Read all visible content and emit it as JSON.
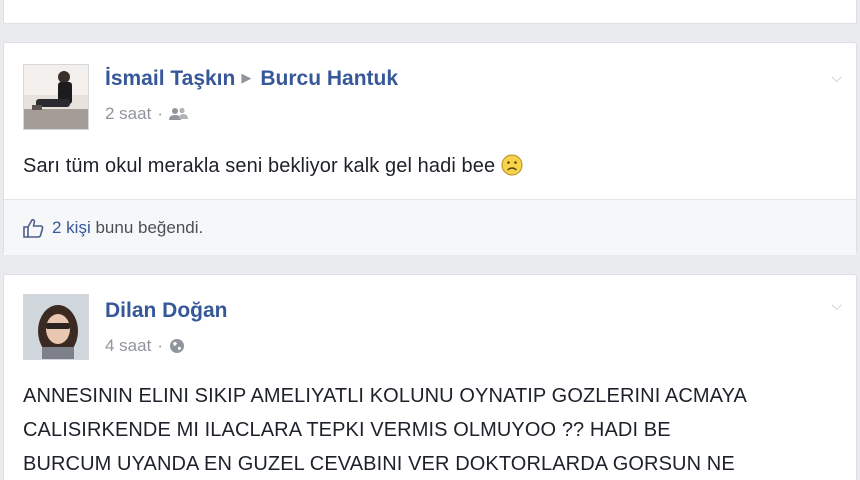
{
  "posts": [
    {
      "author": "İsmail Taşkın",
      "target": "Burcu Hantuk",
      "time": "2 saat",
      "audience_icon": "friends-icon",
      "text": "Sarı tüm okul merakla seni bekliyor kalk gel hadi bee",
      "emoji": "frown-emoticon",
      "likes_count": "2 kişi",
      "likes_text": "bunu beğendi."
    },
    {
      "author": "Dilan Doğan",
      "time": "4 saat",
      "audience_icon": "globe-icon",
      "text_lines": [
        "ANNESININ ELINI SIKIP AMELIYATLI KOLUNU OYNATIP GOZLERINI ACMAYA",
        "CALISIRKENDE MI ILACLARA TEPKI VERMIS OLMUYOO ?? HADI BE",
        "BURCUM UYANDA EN GUZEL CEVABINI VER DOKTORLARDA GORSUN NE"
      ]
    }
  ],
  "colors": {
    "link": "#365899",
    "meta": "#90949c",
    "background": "#e9ebee"
  }
}
